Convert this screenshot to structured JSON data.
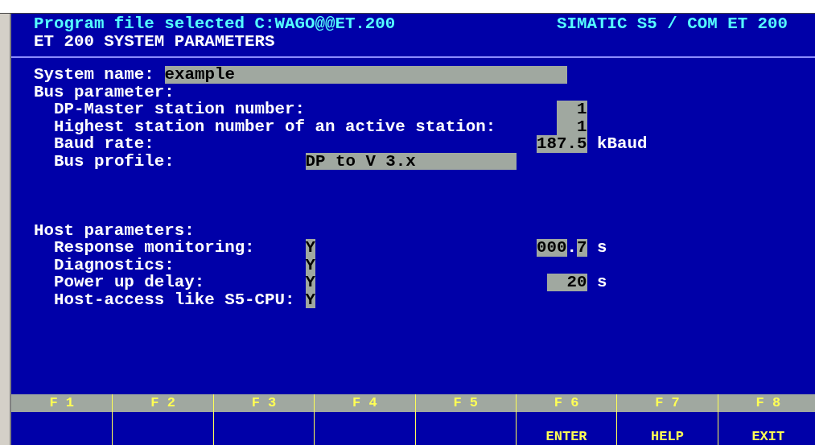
{
  "header": {
    "file": "Program file selected C:WAGO@@ET.200",
    "product": "SIMATIC S5 / COM ET 200",
    "title": "ET 200 SYSTEM PARAMETERS"
  },
  "system_name": {
    "label": "System name:",
    "value": "example"
  },
  "bus": {
    "label": "Bus parameter:",
    "items": [
      {
        "kind": "number",
        "label": "DP-Master station number:",
        "value": "1"
      },
      {
        "kind": "number",
        "label": "Highest station number of an active station:",
        "value": "1"
      },
      {
        "kind": "number",
        "label": "Baud rate:",
        "value": "187.5",
        "unit": "kBaud"
      },
      {
        "kind": "text",
        "label": "Bus profile:",
        "value": "DP to V 3.x"
      }
    ]
  },
  "host": {
    "label": "Host parameters:",
    "items": [
      {
        "label": "Response monitoring:",
        "flag": "Y",
        "value": [
          "000",
          ".",
          "7"
        ],
        "unit": "s"
      },
      {
        "label": "Diagnostics:",
        "flag": "Y"
      },
      {
        "label": "Power up delay:",
        "flag": "Y",
        "value": [
          "20"
        ],
        "unit": "s"
      },
      {
        "label": "Host-access like S5-CPU:",
        "flag": "Y"
      }
    ]
  },
  "function_keys": [
    {
      "key": "F 1"
    },
    {
      "key": "F 2"
    },
    {
      "key": "F 3"
    },
    {
      "key": "F 4"
    },
    {
      "key": "F 5"
    },
    {
      "key": "F 6",
      "label": "ENTER"
    },
    {
      "key": "F 7",
      "label": "HELP"
    },
    {
      "key": "F 8",
      "label": "EXIT"
    }
  ]
}
